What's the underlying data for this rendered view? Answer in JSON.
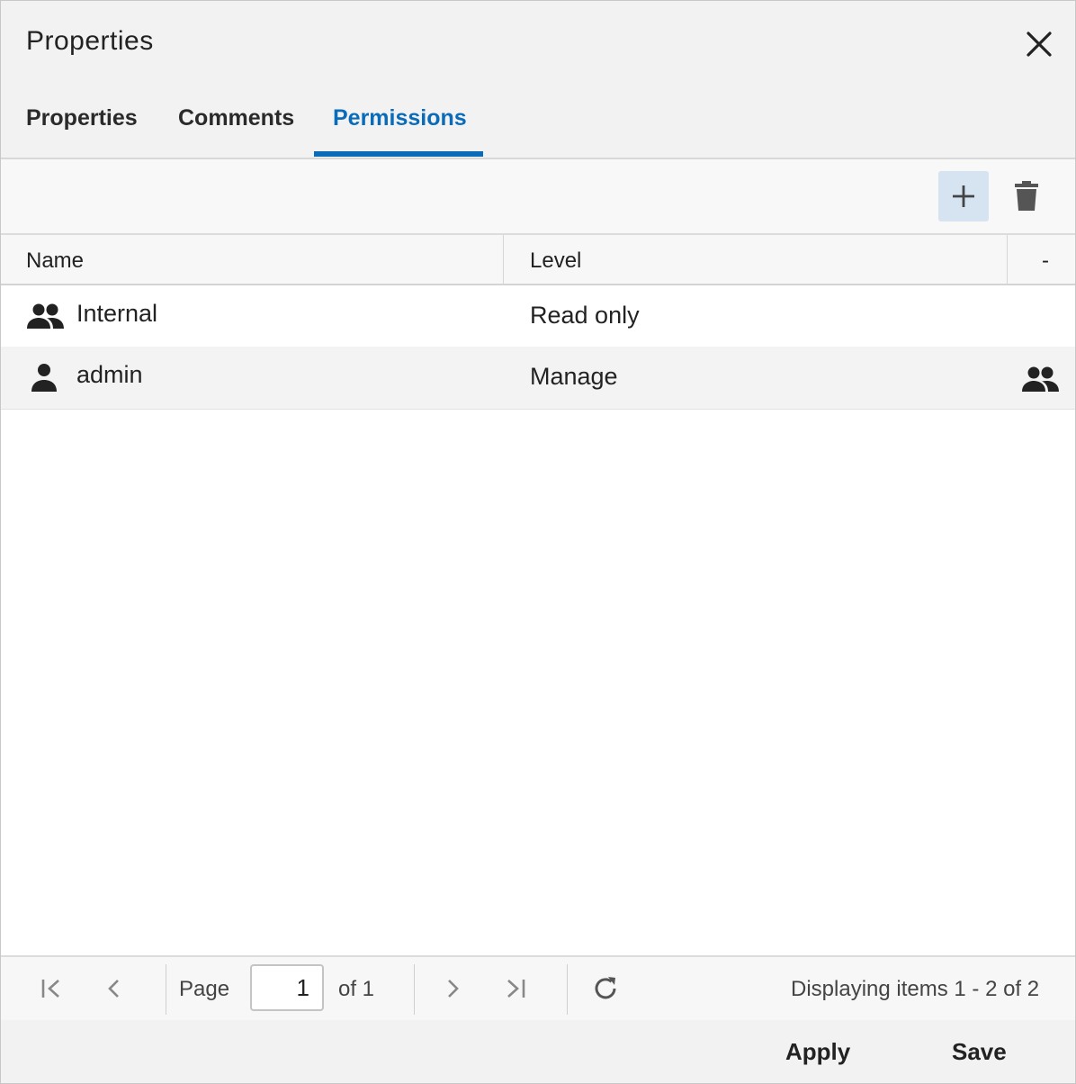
{
  "dialog": {
    "title": "Properties",
    "close_icon": "close-icon"
  },
  "tabs": [
    {
      "label": "Properties",
      "active": false
    },
    {
      "label": "Comments",
      "active": false
    },
    {
      "label": "Permissions",
      "active": true
    }
  ],
  "toolbar": {
    "add_icon": "plus-icon",
    "delete_icon": "trash-icon"
  },
  "grid": {
    "columns": [
      {
        "label": "Name"
      },
      {
        "label": "Level"
      },
      {
        "label": "-"
      }
    ],
    "rows": [
      {
        "icon": "group-icon",
        "name": "Internal",
        "level": "Read only",
        "extra_icon": ""
      },
      {
        "icon": "user-icon",
        "name": "admin",
        "level": "Manage",
        "extra_icon": "group-icon"
      }
    ]
  },
  "paging": {
    "page_label": "Page",
    "page_value": "1",
    "of_label": "of 1",
    "display_info": "Displaying items 1 - 2 of 2"
  },
  "footer": {
    "apply_label": "Apply",
    "save_label": "Save"
  },
  "colors": {
    "accent": "#0a6bb8",
    "add_button_bg": "#d5e4f0",
    "header_bg": "#f2f2f2"
  }
}
